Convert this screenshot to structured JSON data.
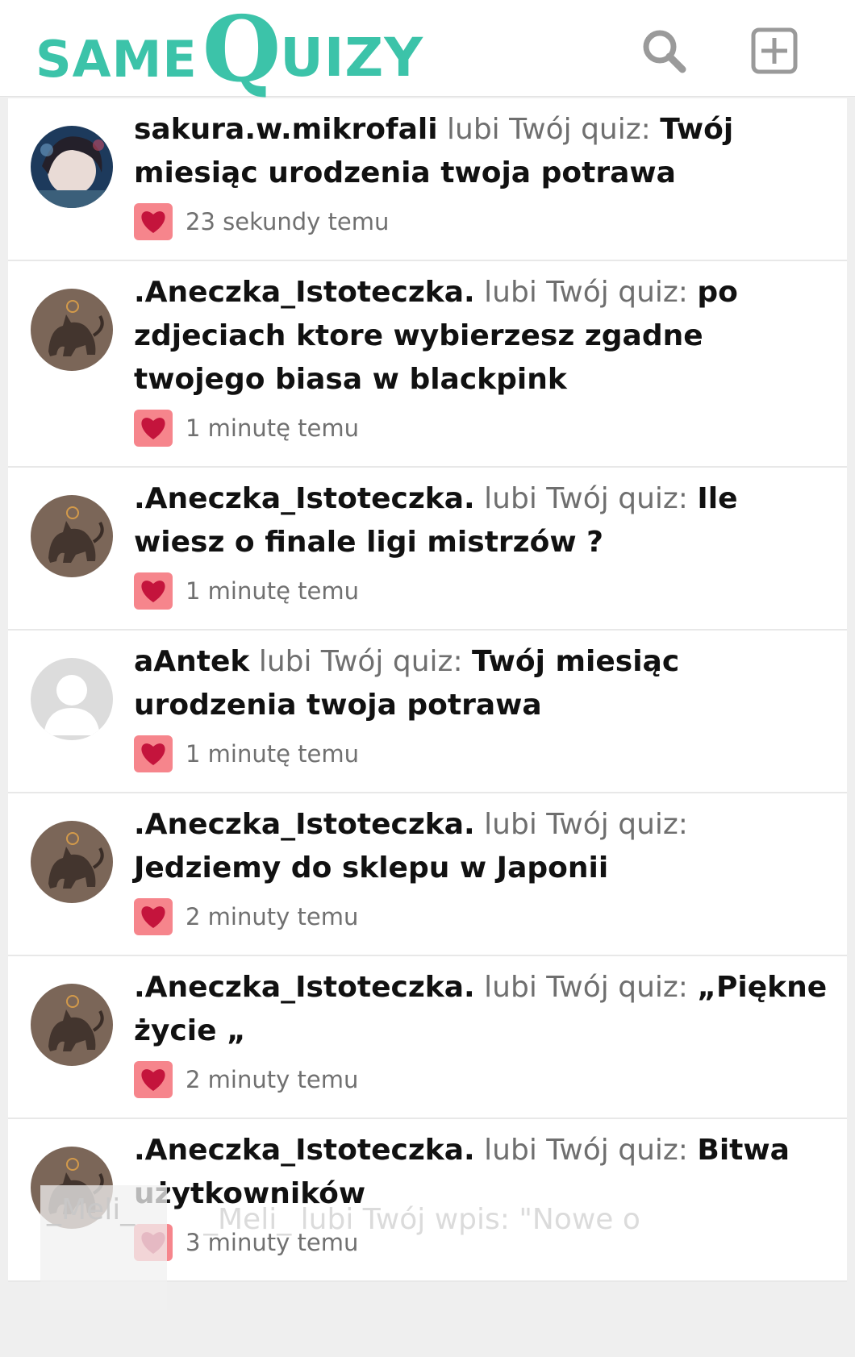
{
  "header": {
    "logo_same": "SAME",
    "logo_q": "Q",
    "logo_uizy": "UIZY",
    "brand_color": "#3cc3a9",
    "search_icon": "search-icon",
    "add_icon": "plus-square-icon"
  },
  "notifications": [
    {
      "user": "sakura.w.mikrofali",
      "action": "lubi Twój quiz:",
      "quiz": "Twój miesiąc urodzenia twoja potrawa",
      "time": "23 sekundy temu",
      "avatar": "photo"
    },
    {
      "user": ".Aneczka_Istoteczka.",
      "action": "lubi Twój quiz:",
      "quiz": "po zdjeciach ktore wybierzesz zgadne twojego biasa w blackpink",
      "time": "1 minutę temu",
      "avatar": "cat"
    },
    {
      "user": ".Aneczka_Istoteczka.",
      "action": "lubi Twój quiz:",
      "quiz": "Ile wiesz o finale ligi mistrzów ?",
      "time": "1 minutę temu",
      "avatar": "cat"
    },
    {
      "user": "aAntek",
      "action": "lubi Twój quiz:",
      "quiz": "Twój miesiąc urodzenia twoja potrawa",
      "time": "1 minutę temu",
      "avatar": "default"
    },
    {
      "user": ".Aneczka_Istoteczka.",
      "action": "lubi Twój quiz:",
      "quiz": "Jedziemy do sklepu w Japonii",
      "time": "2 minuty temu",
      "avatar": "cat"
    },
    {
      "user": ".Aneczka_Istoteczka.",
      "action": "lubi Twój quiz:",
      "quiz": "„Piękne życie „",
      "time": "2 minuty temu",
      "avatar": "cat"
    },
    {
      "user": ".Aneczka_Istoteczka.",
      "action": "lubi Twój quiz:",
      "quiz": "Bitwa użytkowników",
      "time": "3 minuty temu",
      "avatar": "cat"
    }
  ],
  "ghost": {
    "user": "_Meli_",
    "line": "_Meli_ lubi Twój wpis: \"Nowe o"
  },
  "colors": {
    "heart_bg": "#f6858c",
    "heart": "#c4143c"
  }
}
